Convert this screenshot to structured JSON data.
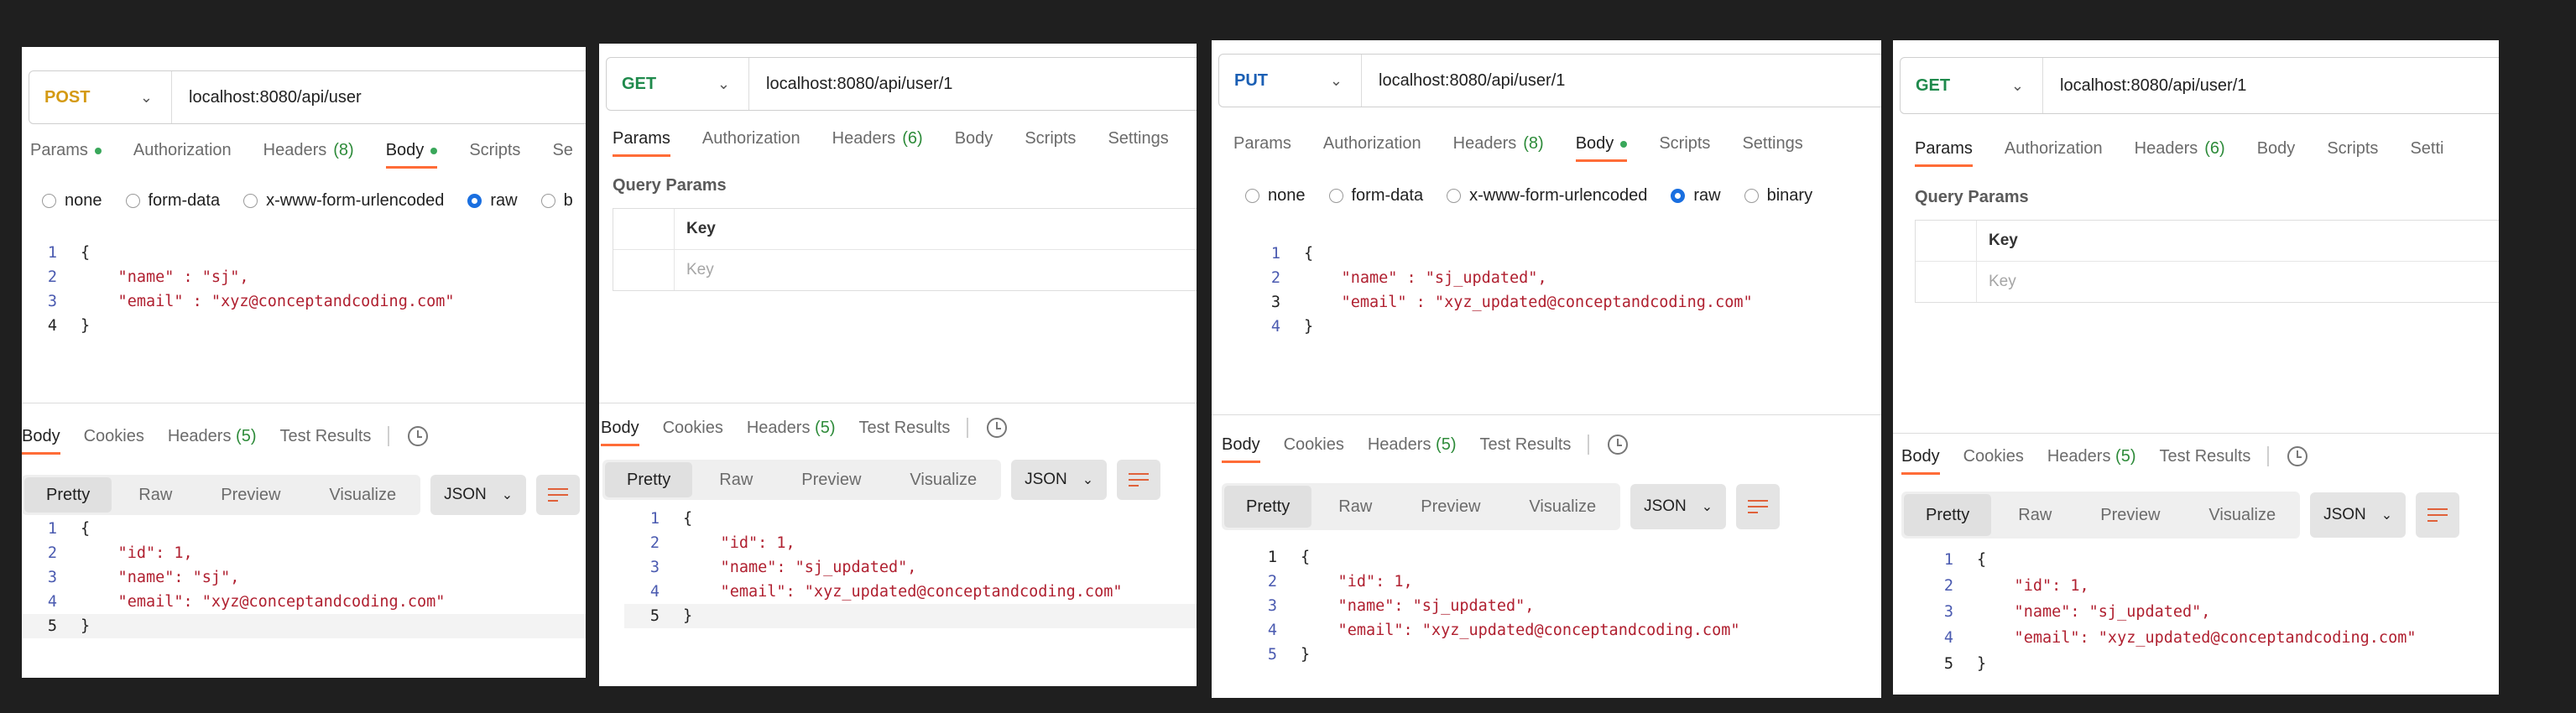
{
  "colors": {
    "accent": "#ff6c37",
    "post": "#d49a13",
    "get": "#1f8a4c",
    "put": "#1a5fb4"
  },
  "panels": [
    {
      "method": "POST",
      "url": "localhost:8080/api/user",
      "tabs": [
        "Params",
        "Authorization",
        "Headers",
        "Body",
        "Scripts",
        "Se"
      ],
      "headers_count": "(8)",
      "radios": [
        "none",
        "form-data",
        "x-www-form-urlencoded",
        "raw",
        "b"
      ],
      "request_lines": [
        "{",
        "    \"name\" : \"sj\",",
        "    \"email\" : \"xyz@conceptandcoding.com\"",
        "}"
      ],
      "response_tabs": [
        "Body",
        "Cookies",
        "Headers",
        "Test Results"
      ],
      "response_headers_count": "(5)",
      "format_buttons": [
        "Pretty",
        "Raw",
        "Preview",
        "Visualize"
      ],
      "format_select": "JSON",
      "response_lines": [
        "{",
        "    \"id\": 1,",
        "    \"name\": \"sj\",",
        "    \"email\": \"xyz@conceptandcoding.com\"",
        "}"
      ]
    },
    {
      "method": "GET",
      "url": "localhost:8080/api/user/1",
      "tabs": [
        "Params",
        "Authorization",
        "Headers",
        "Body",
        "Scripts",
        "Settings"
      ],
      "headers_count": "(6)",
      "query_title": "Query Params",
      "query_header": "Key",
      "query_placeholder": "Key",
      "response_tabs": [
        "Body",
        "Cookies",
        "Headers",
        "Test Results"
      ],
      "response_headers_count": "(5)",
      "format_buttons": [
        "Pretty",
        "Raw",
        "Preview",
        "Visualize"
      ],
      "format_select": "JSON",
      "response_lines": [
        "{",
        "    \"id\": 1,",
        "    \"name\": \"sj_updated\",",
        "    \"email\": \"xyz_updated@conceptandcoding.com\"",
        "}"
      ]
    },
    {
      "method": "PUT",
      "url": "localhost:8080/api/user/1",
      "tabs": [
        "Params",
        "Authorization",
        "Headers",
        "Body",
        "Scripts",
        "Settings"
      ],
      "headers_count": "(8)",
      "radios": [
        "none",
        "form-data",
        "x-www-form-urlencoded",
        "raw",
        "binary"
      ],
      "request_lines": [
        "{",
        "    \"name\" : \"sj_updated\",",
        "    \"email\" : \"xyz_updated@conceptandcoding.com\"",
        "}"
      ],
      "response_tabs": [
        "Body",
        "Cookies",
        "Headers",
        "Test Results"
      ],
      "response_headers_count": "(5)",
      "format_buttons": [
        "Pretty",
        "Raw",
        "Preview",
        "Visualize"
      ],
      "format_select": "JSON",
      "response_lines": [
        "{",
        "    \"id\": 1,",
        "    \"name\": \"sj_updated\",",
        "    \"email\": \"xyz_updated@conceptandcoding.com\"",
        "}"
      ]
    },
    {
      "method": "GET",
      "url": "localhost:8080/api/user/1",
      "tabs": [
        "Params",
        "Authorization",
        "Headers",
        "Body",
        "Scripts",
        "Setti"
      ],
      "headers_count": "(6)",
      "query_title": "Query Params",
      "query_header": "Key",
      "query_placeholder": "Key",
      "response_tabs": [
        "Body",
        "Cookies",
        "Headers",
        "Test Results"
      ],
      "response_headers_count": "(5)",
      "format_buttons": [
        "Pretty",
        "Raw",
        "Preview",
        "Visualize"
      ],
      "format_select": "JSON",
      "response_lines": [
        "{",
        "    \"id\": 1,",
        "    \"name\": \"sj_updated\",",
        "    \"email\": \"xyz_updated@conceptandcoding.com\"",
        "}"
      ]
    }
  ],
  "line_numbers": [
    "1",
    "2",
    "3",
    "4",
    "5"
  ]
}
